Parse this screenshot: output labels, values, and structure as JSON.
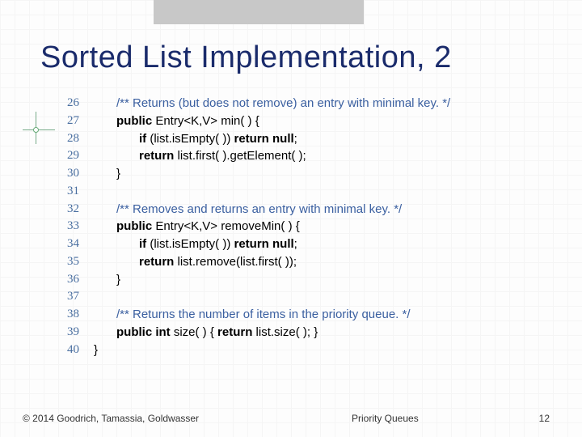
{
  "title": "Sorted List Implementation, 2",
  "code": {
    "lines": [
      {
        "num": "26",
        "kind": "comment",
        "indent": 1,
        "text": "/** Returns (but does not remove) an entry with minimal key. */"
      },
      {
        "num": "27",
        "kind": "mixed",
        "indent": 1,
        "segments": [
          {
            "t": "public",
            "k": true
          },
          {
            "t": " Entry<K,V> min( ) {"
          }
        ]
      },
      {
        "num": "28",
        "kind": "mixed",
        "indent": 2,
        "segments": [
          {
            "t": "if",
            "k": true
          },
          {
            "t": " (list.isEmpty( )) "
          },
          {
            "t": "return null",
            "k": true
          },
          {
            "t": ";"
          }
        ]
      },
      {
        "num": "29",
        "kind": "mixed",
        "indent": 2,
        "segments": [
          {
            "t": "return",
            "k": true
          },
          {
            "t": " list.first( ).getElement( );"
          }
        ]
      },
      {
        "num": "30",
        "kind": "plain",
        "indent": 1,
        "text": "}"
      },
      {
        "num": "31",
        "kind": "blank"
      },
      {
        "num": "32",
        "kind": "comment",
        "indent": 1,
        "text": "/** Removes and returns an entry with minimal key. */"
      },
      {
        "num": "33",
        "kind": "mixed",
        "indent": 1,
        "segments": [
          {
            "t": "public",
            "k": true
          },
          {
            "t": " Entry<K,V> removeMin( ) {"
          }
        ]
      },
      {
        "num": "34",
        "kind": "mixed",
        "indent": 2,
        "segments": [
          {
            "t": "if",
            "k": true
          },
          {
            "t": " (list.isEmpty( )) "
          },
          {
            "t": "return null",
            "k": true
          },
          {
            "t": ";"
          }
        ]
      },
      {
        "num": "35",
        "kind": "mixed",
        "indent": 2,
        "segments": [
          {
            "t": "return",
            "k": true
          },
          {
            "t": " list.remove(list.first( ));"
          }
        ]
      },
      {
        "num": "36",
        "kind": "plain",
        "indent": 1,
        "text": "}"
      },
      {
        "num": "37",
        "kind": "blank"
      },
      {
        "num": "38",
        "kind": "comment",
        "indent": 1,
        "text": "/** Returns the number of items in the priority queue. */"
      },
      {
        "num": "39",
        "kind": "mixed",
        "indent": 1,
        "segments": [
          {
            "t": "public int",
            "k": true
          },
          {
            "t": " size( ) { "
          },
          {
            "t": "return",
            "k": true
          },
          {
            "t": " list.size( ); }"
          }
        ]
      },
      {
        "num": "40",
        "kind": "plain",
        "indent": 0,
        "text": "}"
      }
    ]
  },
  "footer": {
    "copyright": "© 2014 Goodrich, Tamassia, Goldwasser",
    "topic": "Priority Queues",
    "page": "12"
  }
}
